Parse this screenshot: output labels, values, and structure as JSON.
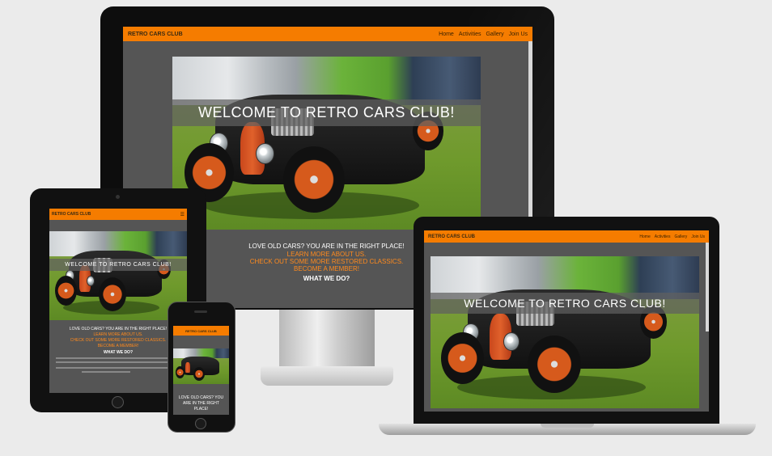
{
  "site": {
    "brand": "RETRO CARS CLUB",
    "nav": [
      "Home",
      "Activities",
      "Gallery",
      "Join Us"
    ],
    "hero_title": "WELCOME TO RETRO CARS CLUB!",
    "tagline": "LOVE OLD CARS? YOU ARE IN THE RIGHT PLACE!",
    "links": [
      "LEARN MORE ABOUT US.",
      "CHECK OUT SOME MORE RESTORED CLASSICS.",
      "BECOME A MEMBER!"
    ],
    "section_heading": "WHAT WE DO?",
    "phone_tagline_1": "LOVE OLD CARS? YOU",
    "phone_tagline_2": "ARE IN THE RIGHT",
    "phone_tagline_3": "PLACE!"
  },
  "colors": {
    "accent": "#f57c00",
    "link_orange": "#ff8a1d",
    "content_bg": "#555555",
    "page_bg": "#ebebeb"
  }
}
